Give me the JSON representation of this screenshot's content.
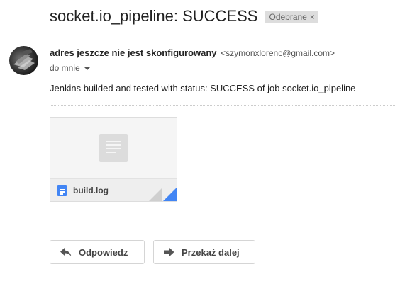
{
  "email": {
    "subject": "socket.io_pipeline: SUCCESS",
    "label": "Odebrane",
    "label_remove": "×",
    "sender_name": "adres jeszcze nie jest skonfigurowany",
    "sender_email": "<szymonxlorenc@gmail.com>",
    "recipient": "do mnie",
    "body": "Jenkins builded and tested with status: SUCCESS of job socket.io_pipeline"
  },
  "attachment": {
    "file_name": "build.log",
    "file_icon": "document-icon",
    "preview_icon": "text-document-icon"
  },
  "actions": {
    "reply_label": "Odpowiedz",
    "reply_icon": "reply-arrow-icon",
    "forward_label": "Przekaż dalej",
    "forward_icon": "forward-arrow-icon"
  },
  "colors": {
    "label_chip_bg": "#dddddd",
    "file_icon_blue": "#4285f4",
    "text": "#222222"
  }
}
